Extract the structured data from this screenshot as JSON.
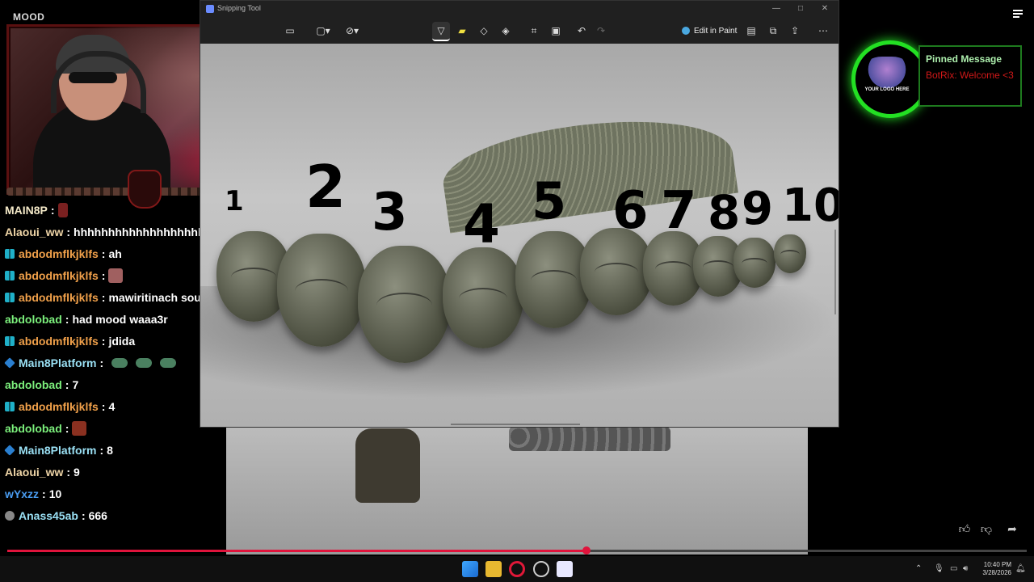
{
  "stream": {
    "title": "MOOD"
  },
  "snipping_tool": {
    "window_title": "Snipping Tool",
    "edit_in_paint_label": "Edit in Paint",
    "window_controls": [
      "—",
      "□",
      "✕"
    ],
    "handwritten_numbers": [
      "1",
      "2",
      "3",
      "4",
      "5",
      "6",
      "7",
      "8",
      "9",
      "10"
    ]
  },
  "chat": [
    {
      "user": "MAIN8P",
      "user_color": "#f4e9c8",
      "badge": "none",
      "message": "",
      "emote": "glyph"
    },
    {
      "user": "Alaoui_ww",
      "user_color": "#f0d6a8",
      "badge": "none",
      "message": "hhhhhhhhhhhhhhhhhhhh",
      "emote": ""
    },
    {
      "user": "abdodmflkjklfs",
      "user_color": "#f0a04a",
      "badge": "grid",
      "message": "ah",
      "emote": ""
    },
    {
      "user": "abdodmflkjklfs",
      "user_color": "#f0a04a",
      "badge": "grid",
      "message": "",
      "emote": "cat"
    },
    {
      "user": "abdodmflkjklfs",
      "user_color": "#f0a04a",
      "badge": "grid",
      "message": "mawiritinach souris",
      "emote": ""
    },
    {
      "user": "abdolobad",
      "user_color": "#7cf07c",
      "badge": "none",
      "message": "had mood waaa3r",
      "emote": ""
    },
    {
      "user": "abdodmflkjklfs",
      "user_color": "#f0a04a",
      "badge": "grid",
      "message": "jdida",
      "emote": ""
    },
    {
      "user": "Main8Platform",
      "user_color": "#9ae0f4",
      "badge": "cube",
      "message": "",
      "emote": "boat3"
    },
    {
      "user": "abdolobad",
      "user_color": "#7cf07c",
      "badge": "none",
      "message": "7",
      "emote": ""
    },
    {
      "user": "abdodmflkjklfs",
      "user_color": "#f0a04a",
      "badge": "grid",
      "message": "4",
      "emote": ""
    },
    {
      "user": "abdolobad",
      "user_color": "#7cf07c",
      "badge": "none",
      "message": "",
      "emote": "brick"
    },
    {
      "user": "Main8Platform",
      "user_color": "#9ae0f4",
      "badge": "cube",
      "message": "8",
      "emote": ""
    },
    {
      "user": "Alaoui_ww",
      "user_color": "#f0d6a8",
      "badge": "none",
      "message": "9",
      "emote": ""
    },
    {
      "user": "wYxzz",
      "user_color": "#4a9cf0",
      "badge": "none",
      "message": "10",
      "emote": ""
    },
    {
      "user": "Anass45ab",
      "user_color": "#9ae0f4",
      "badge": "dot",
      "message": "666",
      "emote": ""
    }
  ],
  "pinned": {
    "title": "Pinned Message",
    "text": "BotRix: Welcome <3",
    "logo_text": "YOUR LOGO HERE"
  },
  "player": {
    "progress": 0.568
  },
  "taskbar": {
    "time": "10:40 PM",
    "date": "3/28/2026"
  },
  "colors": {
    "accent_red": "#e0143c",
    "pinned_green": "#23e023",
    "pinned_text_red": "#d01818"
  }
}
